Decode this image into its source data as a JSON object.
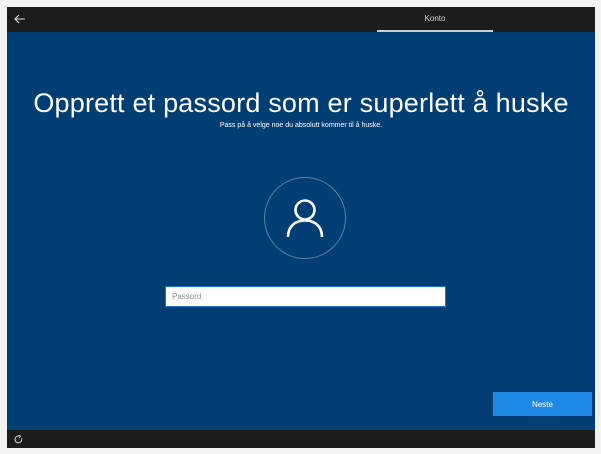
{
  "topbar": {
    "back_icon": "arrow-left-icon",
    "active_tab": "Konto"
  },
  "main": {
    "title": "Opprett et passord som er superlett å huske",
    "subtitle": "Pass på å velge noe du absolutt kommer til å huske.",
    "avatar_icon": "person-icon",
    "password_placeholder": "Passord",
    "password_value": "",
    "next_label": "Neste"
  },
  "bottombar": {
    "ease_of_access_icon": "ease-of-access-icon"
  },
  "colors": {
    "background": "#003e73",
    "bars": "#1c1c1c",
    "accent": "#1e88e5",
    "input_border": "#1e74c8"
  }
}
